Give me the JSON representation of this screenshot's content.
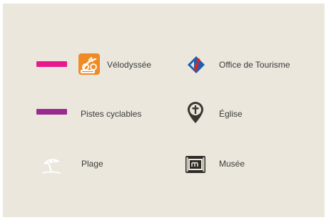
{
  "legend": {
    "items": [
      {
        "label": "Vélodyssée",
        "icon": "velodyssee-logo-icon",
        "line_color": "#e8198b"
      },
      {
        "label": "Pistes cyclables",
        "icon": "bike-path-line",
        "line_color": "#982c8e"
      },
      {
        "label": "Plage",
        "icon": "beach-umbrella-icon"
      },
      {
        "label": "Office de Tourisme",
        "icon": "tourist-office-icon"
      },
      {
        "label": "Église",
        "icon": "church-cross-pin-icon"
      },
      {
        "label": "Musée",
        "icon": "museum-icon"
      }
    ]
  },
  "colors": {
    "background": "#ebe7dd",
    "velodyssee_line": "#e8198b",
    "cycle_path_line": "#982c8e",
    "velodyssee_logo_orange": "#f08a24",
    "tourist_office_blue": "#1b5fae",
    "tourist_office_red": "#e2231a",
    "dark_icon": "#3d3530"
  }
}
